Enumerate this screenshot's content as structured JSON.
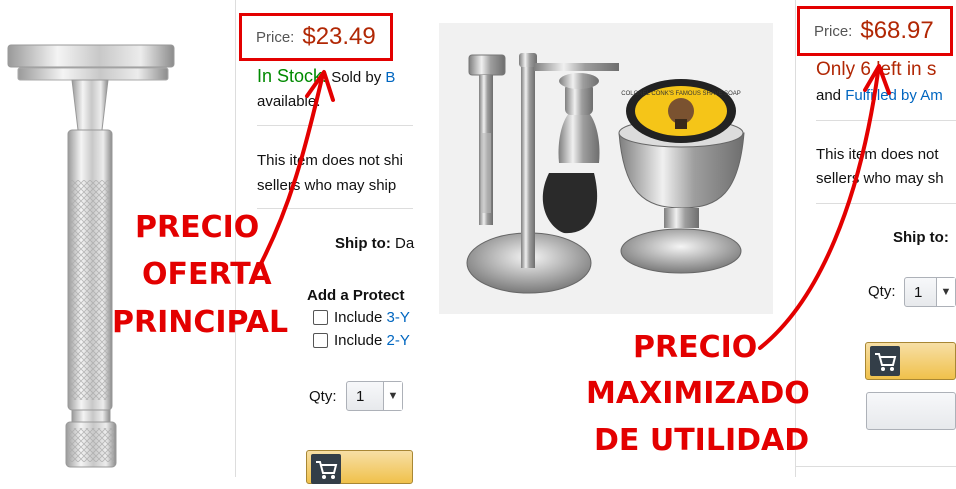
{
  "left_listing": {
    "price_label": "Price:",
    "price_value": "$23.49",
    "stock_text": "In Stock.",
    "sold_by_text": "Sold by",
    "sold_by_link": "B",
    "available_text": "available.",
    "ship_notice_line1": "This item does not shi",
    "ship_notice_line2": "sellers who may ship",
    "ship_to_label": "Ship to:",
    "ship_to_value": "Da",
    "protect_heading": "Add a Protect",
    "protection_options": [
      {
        "label": "Include",
        "link": "3-Y"
      },
      {
        "label": "Include",
        "link": "2-Y"
      }
    ],
    "qty_label": "Qty:",
    "qty_value": "1"
  },
  "right_listing": {
    "price_label": "Price:",
    "price_value": "$68.97",
    "stock_text": "Only 6 left in s",
    "fulfilled_text": "and",
    "fulfilled_link": "Fulfilled by Am",
    "ship_notice_line1": "This item does not",
    "ship_notice_line2": "sellers who may sh",
    "ship_to_label": "Ship to:",
    "qty_label": "Qty:",
    "qty_value": "1"
  },
  "annotations": {
    "left_line1": "PRECIO",
    "left_line2": "OFERTA",
    "left_line3": "PRINCIPAL",
    "right_line1": "PRECIO",
    "right_line2": "MAXIMIZADO",
    "right_line3": "DE UTILIDAD"
  },
  "shaving_soap_label": "COLONEL CONK'S FAMOUS SHAVE SOAP",
  "colors": {
    "annotation_red": "#e30000",
    "price_red": "#b12704",
    "in_stock_green": "#008a00",
    "link_blue": "#0066c0",
    "cart_button_yellow": "#f0c14b"
  },
  "icons": [
    "cart-icon",
    "chevron-down-icon",
    "arrow-icon"
  ]
}
